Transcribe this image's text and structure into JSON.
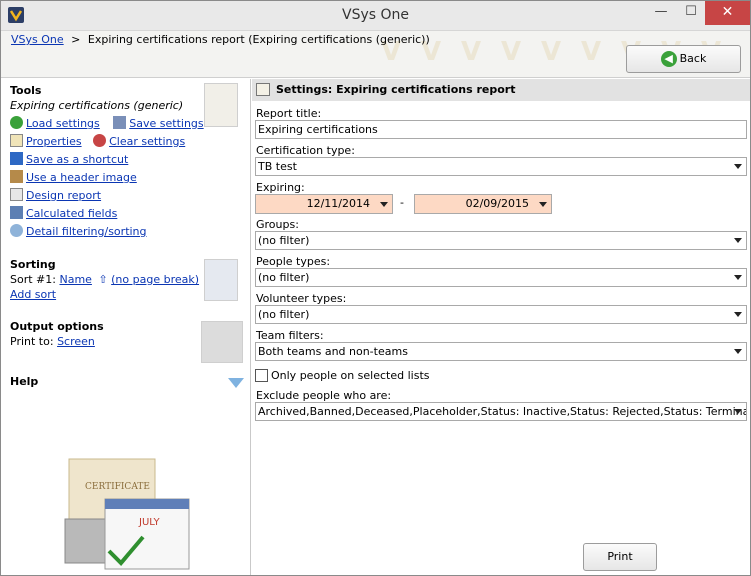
{
  "window": {
    "title": "VSys One",
    "minimize_glyph": "—",
    "maximize_glyph": "☐",
    "close_glyph": "✕"
  },
  "breadcrumb": {
    "root": "VSys One",
    "separator": ">",
    "current": "Expiring certifications report (Expiring certifications (generic))"
  },
  "back_button": {
    "label": "Back",
    "icon": "arrow-left-icon"
  },
  "tools": {
    "title": "Tools",
    "subtitle": "Expiring certifications (generic)",
    "load_settings": "Load settings",
    "save_settings": "Save settings",
    "properties": "Properties",
    "clear_settings": "Clear settings",
    "save_shortcut": "Save as a shortcut",
    "header_image": "Use a header image",
    "design_report": "Design report",
    "calculated_fields": "Calculated fields",
    "detail_filtering": "Detail filtering/sorting"
  },
  "sorting": {
    "title": "Sorting",
    "sort1_label": "Sort #1:",
    "sort1_field": "Name",
    "sort1_break": "(no page break)",
    "add_sort": "Add sort"
  },
  "output": {
    "title": "Output options",
    "print_to_label": "Print to:",
    "print_to_value": "Screen"
  },
  "help": {
    "title": "Help"
  },
  "settings": {
    "header": "Settings: Expiring certifications report",
    "report_title_label": "Report title:",
    "report_title_value": "Expiring certifications",
    "cert_type_label": "Certification type:",
    "cert_type_value": "TB test",
    "expiring_label": "Expiring:",
    "expiring_from": "12/11/2014",
    "expiring_dash": "-",
    "expiring_to": "02/09/2015",
    "groups_label": "Groups:",
    "groups_value": "(no filter)",
    "people_types_label": "People types:",
    "people_types_value": "(no filter)",
    "volunteer_types_label": "Volunteer types:",
    "volunteer_types_value": "(no filter)",
    "team_filters_label": "Team filters:",
    "team_filters_value": "Both teams and non-teams",
    "only_lists_label": "Only people on selected lists",
    "only_lists_checked": false,
    "exclude_label": "Exclude people who are:",
    "exclude_value": "Archived,Banned,Deceased,Placeholder,Status: Inactive,Status: Rejected,Status: Terminated"
  },
  "print_button": {
    "label": "Print"
  },
  "colors": {
    "link": "#0b36b3",
    "date_bg": "#fdd9c4",
    "close_btn": "#c74545",
    "back_icon": "#3aa13a"
  }
}
